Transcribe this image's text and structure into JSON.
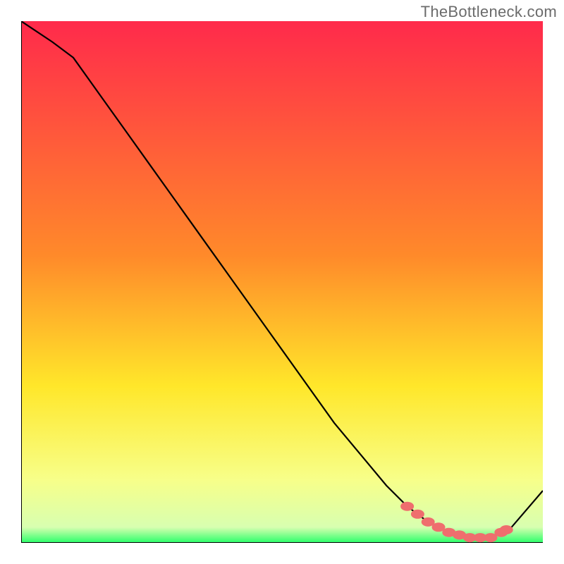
{
  "watermark": "TheBottleneck.com",
  "colors": {
    "gradient_top": "#ff2a4b",
    "gradient_mid1": "#ff8a2a",
    "gradient_mid2": "#ffe72a",
    "gradient_mid3": "#f7ff8a",
    "gradient_bottom": "#2aff6a",
    "line": "#000000",
    "marker": "#ef6e6e"
  },
  "chart_data": {
    "type": "line",
    "title": "",
    "xlabel": "",
    "ylabel": "",
    "xlim": [
      0,
      100
    ],
    "ylim": [
      0,
      100
    ],
    "series": [
      {
        "name": "curve",
        "x": [
          0,
          6,
          10,
          15,
          20,
          25,
          30,
          35,
          40,
          45,
          50,
          55,
          60,
          65,
          70,
          74,
          78,
          82,
          86,
          90,
          94,
          100
        ],
        "values": [
          100,
          96,
          93,
          86,
          79,
          72,
          65,
          58,
          51,
          44,
          37,
          30,
          23,
          17,
          11,
          7,
          4,
          2,
          1,
          1,
          3,
          10
        ]
      }
    ],
    "markers": {
      "name": "highlight-points",
      "x": [
        74,
        76,
        78,
        80,
        82,
        84,
        86,
        88,
        90,
        92,
        93
      ],
      "values": [
        7,
        5.5,
        4,
        3,
        2,
        1.5,
        1,
        1,
        1,
        2,
        2.5
      ]
    },
    "gradient_bands": [
      {
        "stop": 0.0,
        "color": "#ff2a4b"
      },
      {
        "stop": 0.45,
        "color": "#ff8a2a"
      },
      {
        "stop": 0.7,
        "color": "#ffe72a"
      },
      {
        "stop": 0.88,
        "color": "#f7ff8a"
      },
      {
        "stop": 0.97,
        "color": "#d8ffb0"
      },
      {
        "stop": 1.0,
        "color": "#2aff6a"
      }
    ]
  }
}
